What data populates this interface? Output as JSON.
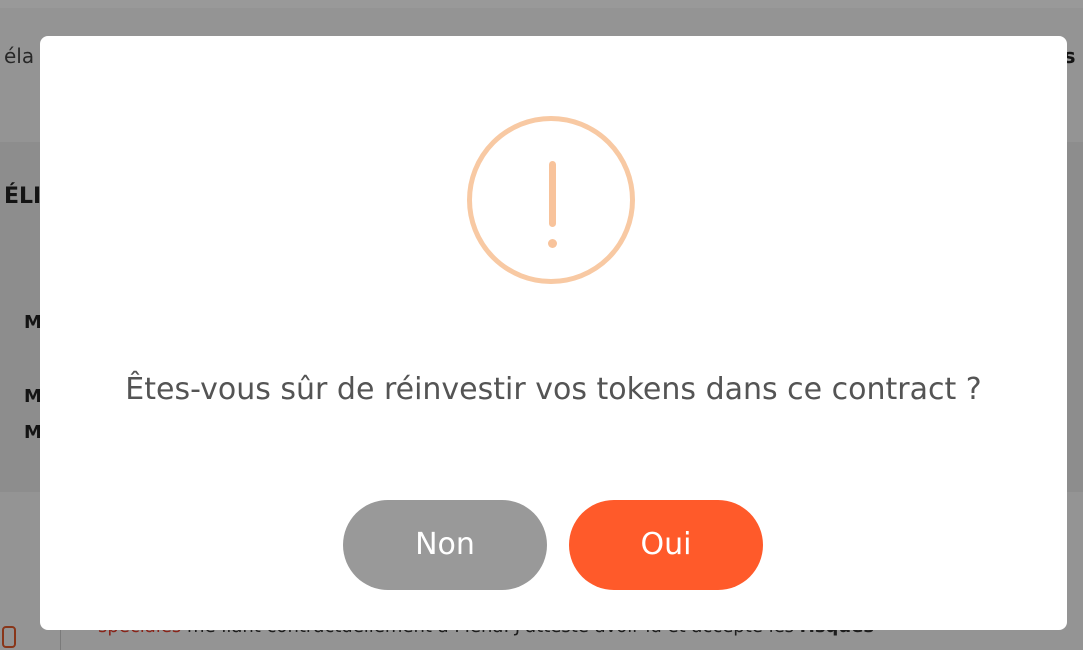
{
  "background": {
    "top_left_text": "éla",
    "top_right_text": "es",
    "section_heading": "ÉLI",
    "row_labels": [
      "M",
      "M",
      "M"
    ],
    "bottom_line": {
      "red_text": "spéciales",
      "normal_text": " me liant contractuellement à Mena. J'atteste avoir lu et accepte les ",
      "bold_text": "risques"
    }
  },
  "dialog": {
    "icon": "exclamation-warning-icon",
    "message": "Êtes-vous sûr de réinvestir vos tokens dans ce contract ?",
    "cancel_label": "Non",
    "confirm_label": "Oui",
    "colors": {
      "warning": "#f8c39b",
      "cancel": "#999999",
      "confirm": "#ff5a2a",
      "text": "#545454"
    }
  }
}
